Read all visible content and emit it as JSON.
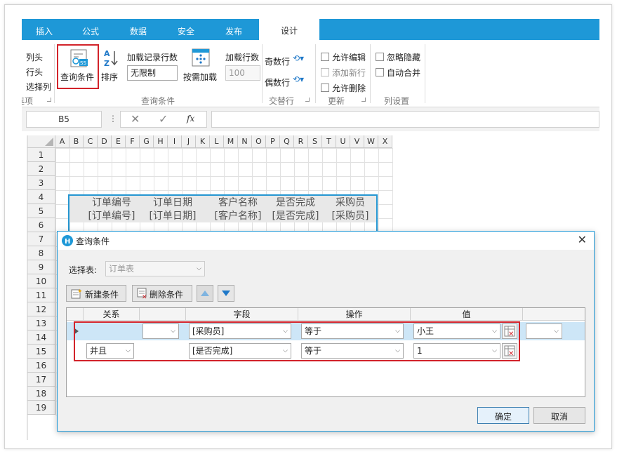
{
  "ribbon_tabs": [
    "插入",
    "公式",
    "数据",
    "安全",
    "发布",
    "设计"
  ],
  "ribbon": {
    "left_items": [
      "列头",
      "行头",
      "选择列"
    ],
    "left_group_label": "选项",
    "query_condition_button": "查询条件",
    "sort_button": "排序",
    "load_rows_label": "加载记录行数",
    "load_rows_value": "无限制",
    "load_on_demand_button": "按需加载",
    "load_count_label": "加载行数",
    "load_count_value": "100",
    "query_group_label": "查询条件",
    "odd_row_button": "奇数行",
    "even_row_button": "偶数行",
    "alternate_group_label": "交替行",
    "allow_edit": "允许编辑",
    "add_new_row": "添加新行",
    "allow_delete": "允许删除",
    "update_group_label": "更新",
    "ignore_hidden": "忽略隐藏",
    "auto_merge": "自动合并",
    "column_group_label": "列设置"
  },
  "formula_bar": {
    "cell_ref": "B5",
    "fx_label": "fx"
  },
  "sheet": {
    "columns": [
      "A",
      "B",
      "C",
      "D",
      "E",
      "F",
      "G",
      "H",
      "I",
      "J",
      "K",
      "L",
      "M",
      "N",
      "O",
      "P",
      "Q",
      "R",
      "S",
      "T",
      "U",
      "V",
      "W",
      "X"
    ],
    "rows": [
      "1",
      "2",
      "3",
      "4",
      "5",
      "6",
      "7",
      "8",
      "9",
      "10",
      "11",
      "12",
      "13",
      "14",
      "15",
      "16",
      "17",
      "18",
      "19"
    ],
    "table_headers": [
      "订单编号",
      "订单日期",
      "客户名称",
      "是否完成",
      "采购员"
    ],
    "table_fields": [
      "[订单编号]",
      "[订单日期]",
      "[客户名称]",
      "[是否完成]",
      "[采购员]"
    ]
  },
  "dialog": {
    "title": "查询条件",
    "select_table_label": "选择表:",
    "select_table_value": "订单表",
    "new_condition_button": "新建条件",
    "delete_condition_button": "删除条件",
    "grid_headers": [
      "关系",
      "字段",
      "操作",
      "值"
    ],
    "conditions": [
      {
        "relation": "",
        "field": "[采购员]",
        "operator": "等于",
        "value": "小王"
      },
      {
        "relation": "并且",
        "field": "[是否完成]",
        "operator": "等于",
        "value": "1"
      }
    ],
    "ok_button": "确定",
    "cancel_button": "取消"
  },
  "colors": {
    "accent": "#1e98d7",
    "highlight": "#d2232a",
    "selected_row": "#cde6f7"
  }
}
